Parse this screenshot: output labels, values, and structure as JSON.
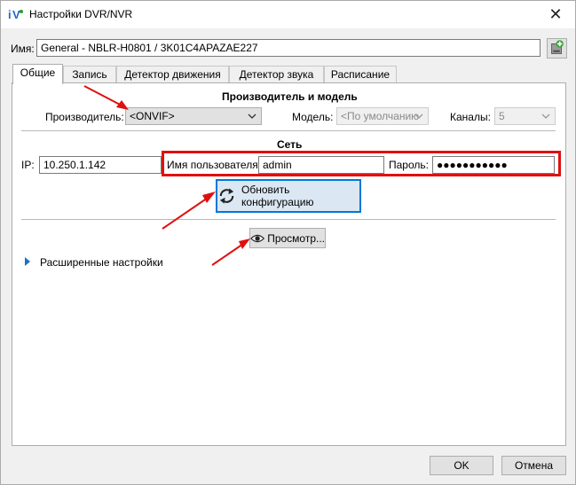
{
  "window": {
    "title": "Настройки DVR/NVR",
    "app_icon_text": "iV",
    "close_glyph": "✕"
  },
  "name_field": {
    "label": "Имя:",
    "value": "General - NBLR-H0801 / 3K01C4APAZAE227"
  },
  "tabs": [
    {
      "label": "Общие"
    },
    {
      "label": "Запись"
    },
    {
      "label": "Детектор движения"
    },
    {
      "label": "Детектор звука"
    },
    {
      "label": "Расписание"
    }
  ],
  "manufacturer_section": {
    "title": "Производитель и модель",
    "manufacturer_label": "Производитель:",
    "manufacturer_value": "<ONVIF>",
    "model_label": "Модель:",
    "model_value": "<По умолчанию",
    "channels_label": "Каналы:",
    "channels_value": "5"
  },
  "network_section": {
    "title": "Сеть",
    "ip_label": "IP:",
    "ip_value": "10.250.1.142",
    "username_label": "Имя пользователя:",
    "username_value": "admin",
    "password_label": "Пароль:",
    "password_value": "●●●●●●●●●●●"
  },
  "buttons": {
    "update_config": "Обновить конфигурацию",
    "preview": "Просмотр...",
    "ok": "OK",
    "cancel": "Отмена"
  },
  "advanced": {
    "label": "Расширенные настройки"
  },
  "colors": {
    "highlight_red": "#e01010",
    "focus_blue": "#0078d7"
  }
}
